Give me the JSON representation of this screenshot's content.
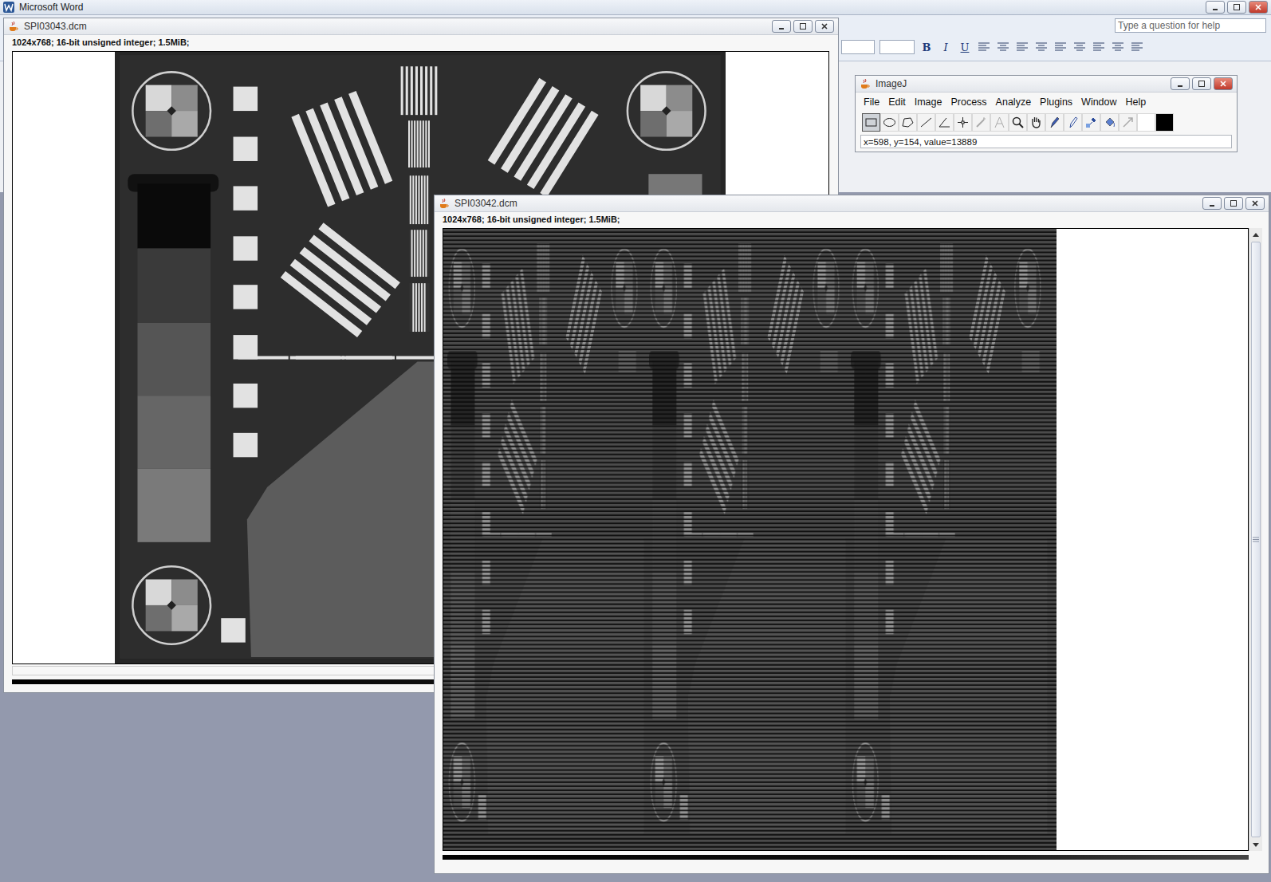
{
  "word": {
    "title": "Microsoft Word",
    "help_placeholder": "Type a question for help",
    "format_buttons": [
      "B",
      "I",
      "U"
    ]
  },
  "imagej": {
    "title": "ImageJ",
    "menu": [
      "File",
      "Edit",
      "Image",
      "Process",
      "Analyze",
      "Plugins",
      "Window",
      "Help"
    ],
    "tools": [
      {
        "kind": "rectangle",
        "selected": true,
        "disabled": false
      },
      {
        "kind": "oval",
        "selected": false,
        "disabled": false
      },
      {
        "kind": "polygon",
        "selected": false,
        "disabled": false
      },
      {
        "kind": "line",
        "selected": false,
        "disabled": false
      },
      {
        "kind": "angle",
        "selected": false,
        "disabled": false
      },
      {
        "kind": "point",
        "selected": false,
        "disabled": false
      },
      {
        "kind": "wand",
        "selected": false,
        "disabled": true
      },
      {
        "kind": "text",
        "selected": false,
        "disabled": true
      },
      {
        "kind": "magnifier",
        "selected": false,
        "disabled": false
      },
      {
        "kind": "hand",
        "selected": false,
        "disabled": false
      },
      {
        "kind": "pen",
        "selected": false,
        "disabled": false
      },
      {
        "kind": "pencil",
        "selected": false,
        "disabled": false
      },
      {
        "kind": "dropper",
        "selected": false,
        "disabled": false
      },
      {
        "kind": "fill",
        "selected": false,
        "disabled": false
      },
      {
        "kind": "arrow",
        "selected": false,
        "disabled": true
      },
      {
        "kind": "color",
        "selected": false,
        "disabled": false,
        "color": "#ffffff"
      },
      {
        "kind": "color",
        "selected": false,
        "disabled": false,
        "color": "#000000"
      }
    ],
    "status": "x=598, y=154, value=13889"
  },
  "images": [
    {
      "title": "SPI03043.dcm",
      "info": "1024x768; 16-bit unsigned integer; 1.5MiB;",
      "kind": "phantom"
    },
    {
      "title": "SPI03042.dcm",
      "info": "1024x768; 16-bit unsigned integer; 1.5MiB;",
      "kind": "striped"
    }
  ]
}
